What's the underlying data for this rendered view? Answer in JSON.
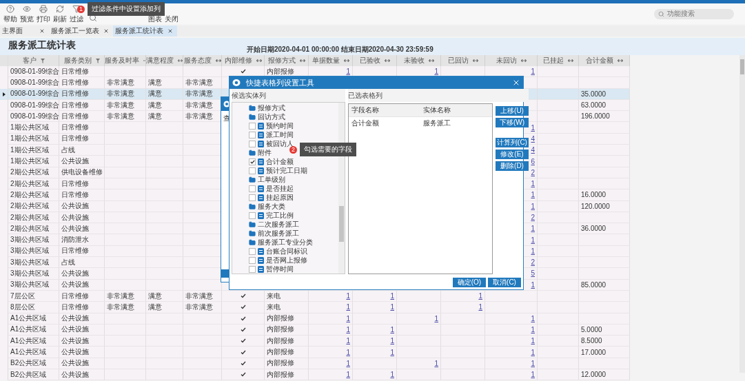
{
  "toolbar": {
    "items": [
      {
        "kind": "icon-label",
        "label": "帮助"
      },
      {
        "kind": "icon-label",
        "label": "预览"
      },
      {
        "kind": "icon-label",
        "label": "打印"
      },
      {
        "kind": "icon-label",
        "label": "刷新"
      },
      {
        "kind": "icon-label",
        "label": "过滤"
      },
      {
        "kind": "icon"
      },
      {
        "kind": "label",
        "label": "图表"
      },
      {
        "kind": "label",
        "label": "关闭"
      }
    ],
    "search": {
      "placeholder": "功能搜索"
    }
  },
  "callouts": [
    {
      "number": "1",
      "text": "过滤条件中设置添加列"
    },
    {
      "number": "2",
      "text": "勾选需要的字段"
    }
  ],
  "tabs": [
    {
      "label": "主界面",
      "selected": false
    },
    {
      "label": "服务派工一览表",
      "selected": false
    },
    {
      "label": "服务派工统计表",
      "selected": true
    }
  ],
  "report": {
    "title": "服务派工统计表",
    "date_range": "开始日期2020-04-01 00:00:00 结束日期2020-04-30 23:59:59"
  },
  "table": {
    "columns": [
      "客户",
      "服务类别",
      "服务及时率",
      "满意程度",
      "服务态度",
      "内部维修",
      "报修方式",
      "单据数量",
      "已验收",
      "未验收",
      "已回访",
      "未回访",
      "已挂起",
      "合计金额"
    ],
    "rows": [
      {
        "selected": false,
        "customer": "0908-01-99综合",
        "category": "日常维修",
        "internal_repair": true,
        "method": "内部报修",
        "count": "1",
        "not_accepted": "1",
        "not_visited": "1"
      },
      {
        "selected": false,
        "customer": "0908-01-99综合",
        "category": "日常维修",
        "timeliness": "非常满意",
        "satisfaction": "满意",
        "attitude": "非常满意"
      },
      {
        "selected": true,
        "customer": "0908-01-99综合",
        "category": "日常维修",
        "timeliness": "非常满意",
        "satisfaction": "满意",
        "attitude": "非常满意",
        "amount": "35.0000"
      },
      {
        "selected": false,
        "customer": "0908-01-99综合",
        "category": "日常维修",
        "timeliness": "非常满意",
        "satisfaction": "满意",
        "attitude": "非常满意",
        "amount": "63.0000"
      },
      {
        "selected": false,
        "customer": "0908-01-99综合",
        "category": "日常维修",
        "timeliness": "非常满意",
        "satisfaction": "满意",
        "attitude": "非常满意",
        "amount": "196.0000"
      },
      {
        "selected": false,
        "customer": "1期公共区域",
        "category": "日常维修",
        "not_visited": "1"
      },
      {
        "selected": false,
        "customer": "1期公共区域",
        "category": "日常维修",
        "not_visited": "4"
      },
      {
        "selected": false,
        "customer": "1期公共区域",
        "category": "占线",
        "not_visited": "4"
      },
      {
        "selected": false,
        "customer": "1期公共区域",
        "category": "公共设施",
        "not_visited": "6"
      },
      {
        "selected": false,
        "customer": "2期公共区域",
        "category": "供电设备维修",
        "not_visited": "2"
      },
      {
        "selected": false,
        "customer": "2期公共区域",
        "category": "日常维修",
        "not_visited": "1"
      },
      {
        "selected": false,
        "customer": "2期公共区域",
        "category": "日常维修",
        "not_visited": "1",
        "amount": "16.0000"
      },
      {
        "selected": false,
        "customer": "2期公共区域",
        "category": "公共设施",
        "not_visited": "1",
        "amount": "120.0000"
      },
      {
        "selected": false,
        "customer": "2期公共区域",
        "category": "公共设施",
        "not_visited": "2"
      },
      {
        "selected": false,
        "customer": "2期公共区域",
        "category": "公共设施",
        "not_visited": "1",
        "amount": "36.0000"
      },
      {
        "selected": false,
        "customer": "3期公共区域",
        "category": "消防泄水",
        "not_visited": "1"
      },
      {
        "selected": false,
        "customer": "3期公共区域",
        "category": "日常维修",
        "not_visited": "1"
      },
      {
        "selected": false,
        "customer": "3期公共区域",
        "category": "占线",
        "not_visited": "2"
      },
      {
        "selected": false,
        "customer": "3期公共区域",
        "category": "公共设施",
        "not_visited": "5"
      },
      {
        "selected": false,
        "customer": "3期公共区域",
        "category": "公共设施",
        "not_visited": "1",
        "amount": "85.0000"
      },
      {
        "selected": false,
        "customer": "7层公区",
        "category": "日常维修",
        "timeliness": "非常满意",
        "satisfaction": "满意",
        "attitude": "非常满意",
        "internal_repair": true,
        "method": "来电",
        "count": "1",
        "accepted": "1",
        "visited": "1"
      },
      {
        "selected": false,
        "customer": "8层公区",
        "category": "日常维修",
        "timeliness": "非常满意",
        "satisfaction": "满意",
        "attitude": "非常满意",
        "internal_repair": true,
        "method": "来电",
        "count": "1",
        "accepted": "1",
        "visited": "1"
      },
      {
        "selected": false,
        "customer": "A1公共区域",
        "category": "公共设施",
        "internal_repair": true,
        "method": "内部报修",
        "count": "1",
        "not_accepted": "1",
        "not_visited": "1"
      },
      {
        "selected": false,
        "customer": "A1公共区域",
        "category": "公共设施",
        "internal_repair": true,
        "method": "内部报修",
        "count": "1",
        "accepted": "1",
        "not_visited": "1",
        "amount": "5.0000"
      },
      {
        "selected": false,
        "customer": "A1公共区域",
        "category": "公共设施",
        "internal_repair": true,
        "method": "内部报修",
        "count": "1",
        "accepted": "1",
        "not_visited": "1",
        "amount": "8.5000"
      },
      {
        "selected": false,
        "customer": "A1公共区域",
        "category": "公共设施",
        "internal_repair": true,
        "method": "内部报修",
        "count": "1",
        "accepted": "1",
        "not_visited": "1",
        "amount": "17.0000"
      },
      {
        "selected": false,
        "customer": "B2公共区域",
        "category": "公共设施",
        "internal_repair": true,
        "method": "内部报修",
        "count": "1",
        "not_accepted": "1",
        "not_visited": "1"
      },
      {
        "selected": false,
        "customer": "B2公共区域",
        "category": "公共设施",
        "internal_repair": true,
        "method": "内部报修",
        "count": "1",
        "accepted": "1",
        "not_visited": "1",
        "amount": "12.0000"
      }
    ]
  },
  "background_dialog": {
    "text": "查"
  },
  "dialog": {
    "title": "快捷表格列设置工具",
    "left_label": "候选实体列",
    "right_label": "已选表格列",
    "tree": [
      {
        "kind": "folder",
        "label": "报修方式"
      },
      {
        "kind": "folder",
        "label": "回访方式"
      },
      {
        "kind": "field",
        "label": "预约时间",
        "checked": false
      },
      {
        "kind": "field",
        "label": "派工时间",
        "checked": false
      },
      {
        "kind": "field",
        "label": "被回访人",
        "checked": false
      },
      {
        "kind": "folder",
        "label": "附件"
      },
      {
        "kind": "field",
        "label": "合计金额",
        "checked": true
      },
      {
        "kind": "field",
        "label": "预计完工日期",
        "checked": false
      },
      {
        "kind": "folder",
        "label": "工单级别"
      },
      {
        "kind": "field",
        "label": "是否挂起",
        "checked": false
      },
      {
        "kind": "field",
        "label": "挂起原因",
        "checked": false
      },
      {
        "kind": "folder",
        "label": "服务大类"
      },
      {
        "kind": "field",
        "label": "完工比例",
        "checked": false
      },
      {
        "kind": "folder",
        "label": "二次服务派工"
      },
      {
        "kind": "folder",
        "label": "前次服务派工"
      },
      {
        "kind": "folder",
        "label": "服务派工专业分类"
      },
      {
        "kind": "field",
        "label": "台账合同标识",
        "checked": false
      },
      {
        "kind": "field",
        "label": "是否网上报修",
        "checked": false
      },
      {
        "kind": "field",
        "label": "暂停时间",
        "checked": false
      }
    ],
    "selected_columns": {
      "columns": [
        "字段名称",
        "实体名称"
      ],
      "rows": [
        [
          "合计金额",
          "服务派工"
        ]
      ]
    },
    "side_buttons": [
      {
        "label": "上移(U)"
      },
      {
        "label": "下移(W)"
      },
      {
        "label": "计算列(C)"
      },
      {
        "label": "修改(E)"
      },
      {
        "label": "删除(D)"
      }
    ],
    "footer_buttons": [
      "确定(O)",
      "取消(C)"
    ]
  }
}
